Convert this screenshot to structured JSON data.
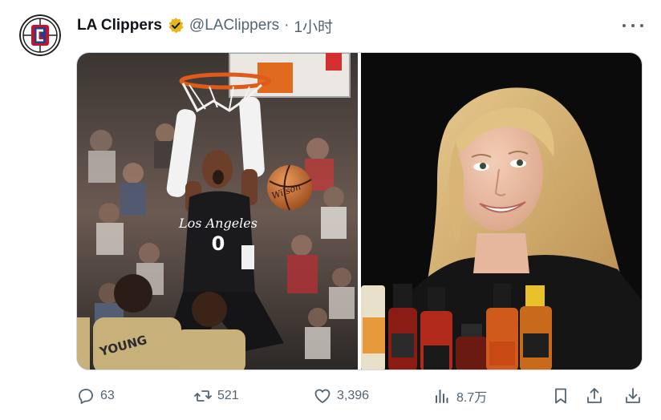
{
  "tweet": {
    "author": {
      "display_name": "LA Clippers",
      "handle": "@LAClippers",
      "separator": "·",
      "time": "1小时",
      "verified_color": "#e8b619",
      "avatar_icon": "clippers-logo-icon"
    },
    "media": [
      {
        "alt_icon": "basketball-dunk-photo",
        "jersey_text": "Los Angeles",
        "jersey_number": "0",
        "ball_text": "Wilson",
        "opponent_name": "YOUNG"
      },
      {
        "alt_icon": "hot-sauce-interview-photo"
      }
    ],
    "stats": {
      "replies": "63",
      "retweets": "521",
      "likes": "3,396",
      "views": "8.7万"
    }
  },
  "colors": {
    "text": "#0f1419",
    "secondary": "#536471",
    "clippers_red": "#c8102e",
    "clippers_blue": "#1d428a"
  }
}
